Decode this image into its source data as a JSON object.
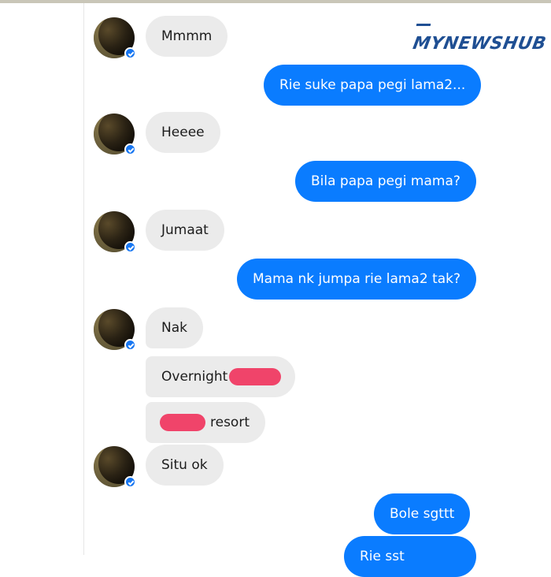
{
  "watermark": "MYNEWSHUB",
  "colors": {
    "outgoing": "#0a7cff",
    "incoming": "#ebebeb",
    "redaction": "#f0446a",
    "brand": "#1f4f93"
  },
  "messages": [
    {
      "side": "in",
      "text": "Mmmm",
      "avatar": true
    },
    {
      "side": "out",
      "text": "Rie suke papa pegi lama2..."
    },
    {
      "side": "in",
      "text": "Heeee",
      "avatar": true
    },
    {
      "side": "out",
      "text": "Bila papa pegi mama?"
    },
    {
      "side": "in",
      "text": "Jumaat",
      "avatar": true
    },
    {
      "side": "out",
      "text": "Mama nk jumpa rie lama2 tak?"
    },
    {
      "side": "in",
      "text": "Nak"
    },
    {
      "side": "in",
      "text": "Overnight"
    },
    {
      "side": "in",
      "text": "resort"
    },
    {
      "side": "in",
      "text": "Situ ok",
      "avatar": true
    },
    {
      "side": "out",
      "text": "Bole sgttt"
    },
    {
      "side": "out",
      "text": "Rie sst"
    }
  ]
}
